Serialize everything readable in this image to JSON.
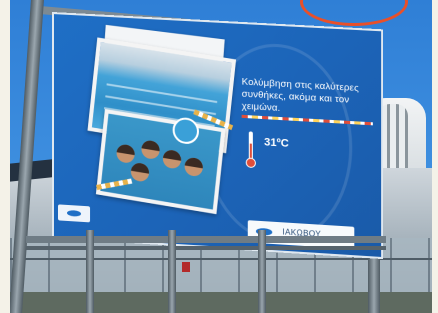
{
  "billboard": {
    "headline": "Κολύμβηση στις καλύτερες συνθήκες, ακόμα και τον χειμώνα.",
    "temperature": "31ºC",
    "sponsor_name": "ΙΑΚΩΒΟΥ"
  },
  "colors": {
    "billboard_blue": "#1f6fc6",
    "sky_blue": "#3f90e0",
    "accent_red": "#e04e3a",
    "marker_orange": "#e8502a"
  },
  "icons": [
    "thermometer-icon",
    "swimmer-wave-logo"
  ]
}
